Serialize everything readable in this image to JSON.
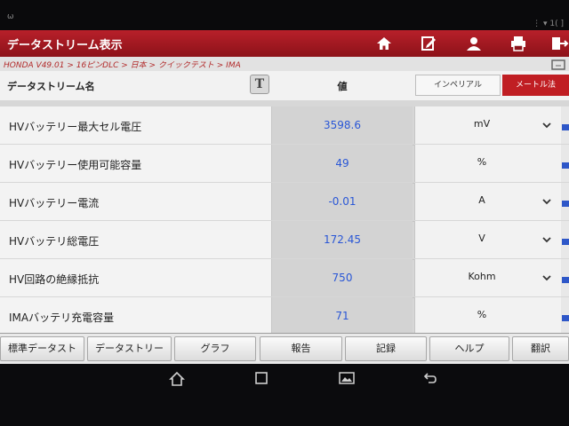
{
  "statusbar": {
    "left_text": "ω",
    "right_text": "⋮ ▾ 1( ]"
  },
  "app": {
    "title": "データストリーム表示",
    "toolbar_icons": [
      "home-icon",
      "edit-icon",
      "user-icon",
      "printer-icon",
      "exit-icon"
    ]
  },
  "breadcrumb": "HONDA V49.01 > 16ピンDLC > 日本 > クイックテスト > IMA",
  "table": {
    "header_name": "データストリーム名",
    "header_t": "T",
    "header_value": "値",
    "unit_toggle": {
      "imperial": "インペリアル",
      "metric": "メートル法"
    },
    "rows": [
      {
        "name": "HVバッテリー最大セル電圧",
        "value": "3598.6",
        "unit": "mV",
        "dropdown": true
      },
      {
        "name": "HVバッテリー使用可能容量",
        "value": "49",
        "unit": "%",
        "dropdown": false
      },
      {
        "name": "HVバッテリー電流",
        "value": "-0.01",
        "unit": "A",
        "dropdown": true
      },
      {
        "name": "HVバッテリ総電圧",
        "value": "172.45",
        "unit": "V",
        "dropdown": true
      },
      {
        "name": "HV回路の絶縁抵抗",
        "value": "750",
        "unit": "Kohm",
        "dropdown": true
      },
      {
        "name": "IMAバッテリ充電容量",
        "value": "71",
        "unit": "%",
        "dropdown": false
      }
    ]
  },
  "bottom_toolbar": {
    "buttons": [
      "標準データスト",
      "データストリー",
      "グラフ",
      "報告",
      "記録",
      "ヘルプ",
      "翻訳"
    ]
  },
  "android_nav": [
    "home-nav-icon",
    "recents-icon",
    "gallery-icon",
    "back-icon"
  ],
  "colors": {
    "brand_red": "#b8202a",
    "value_blue": "#2a57d6"
  }
}
